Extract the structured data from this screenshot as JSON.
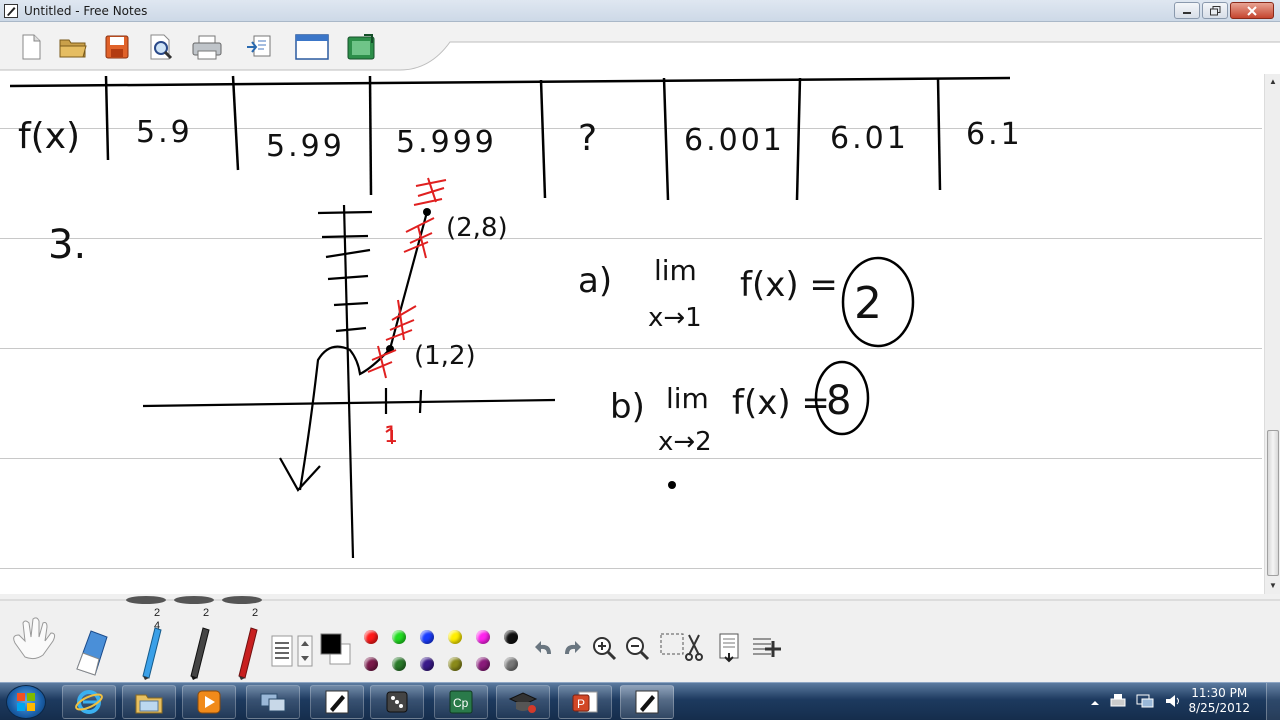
{
  "window": {
    "title": "Untitled - Free Notes"
  },
  "toolbar": {
    "buttons": [
      "new-file",
      "open-folder",
      "save",
      "search-page",
      "print",
      "export",
      "window",
      "screen-capture"
    ]
  },
  "notes": {
    "table_row_label": "f(x)",
    "table_values": [
      "5.9",
      "5.99",
      "5.999",
      "?",
      "6.001",
      "6.01",
      "6.1"
    ],
    "problem_number": "3.",
    "point_a_label": "(2,8)",
    "point_b_label": "(1,2)",
    "red_tick_label": "1",
    "part_a": {
      "prefix": "a)",
      "lim": "lim",
      "subscript": "x→1",
      "expr": "f(x) =",
      "answer": "2"
    },
    "part_b": {
      "prefix": "b)",
      "lim": "lim",
      "subscript": "x→2",
      "expr": "f(x) =",
      "answer": "8"
    }
  },
  "tool_panel": {
    "pen_tab_counts": [
      "2",
      "2",
      "2"
    ],
    "pen_tab_sub": "4",
    "current_color": "#000000",
    "palette_top": [
      "#ff1a1a",
      "#22dd22",
      "#1a3cff",
      "#ffee00",
      "#ff22ee",
      "#111111"
    ],
    "palette_bottom": [
      "#7a1a4a",
      "#2a7a2a",
      "#3a1a8a",
      "#8a8a1a",
      "#8a1a7a",
      "#777777"
    ]
  },
  "taskbar": {
    "time": "11:30 PM",
    "date": "8/25/2012"
  }
}
